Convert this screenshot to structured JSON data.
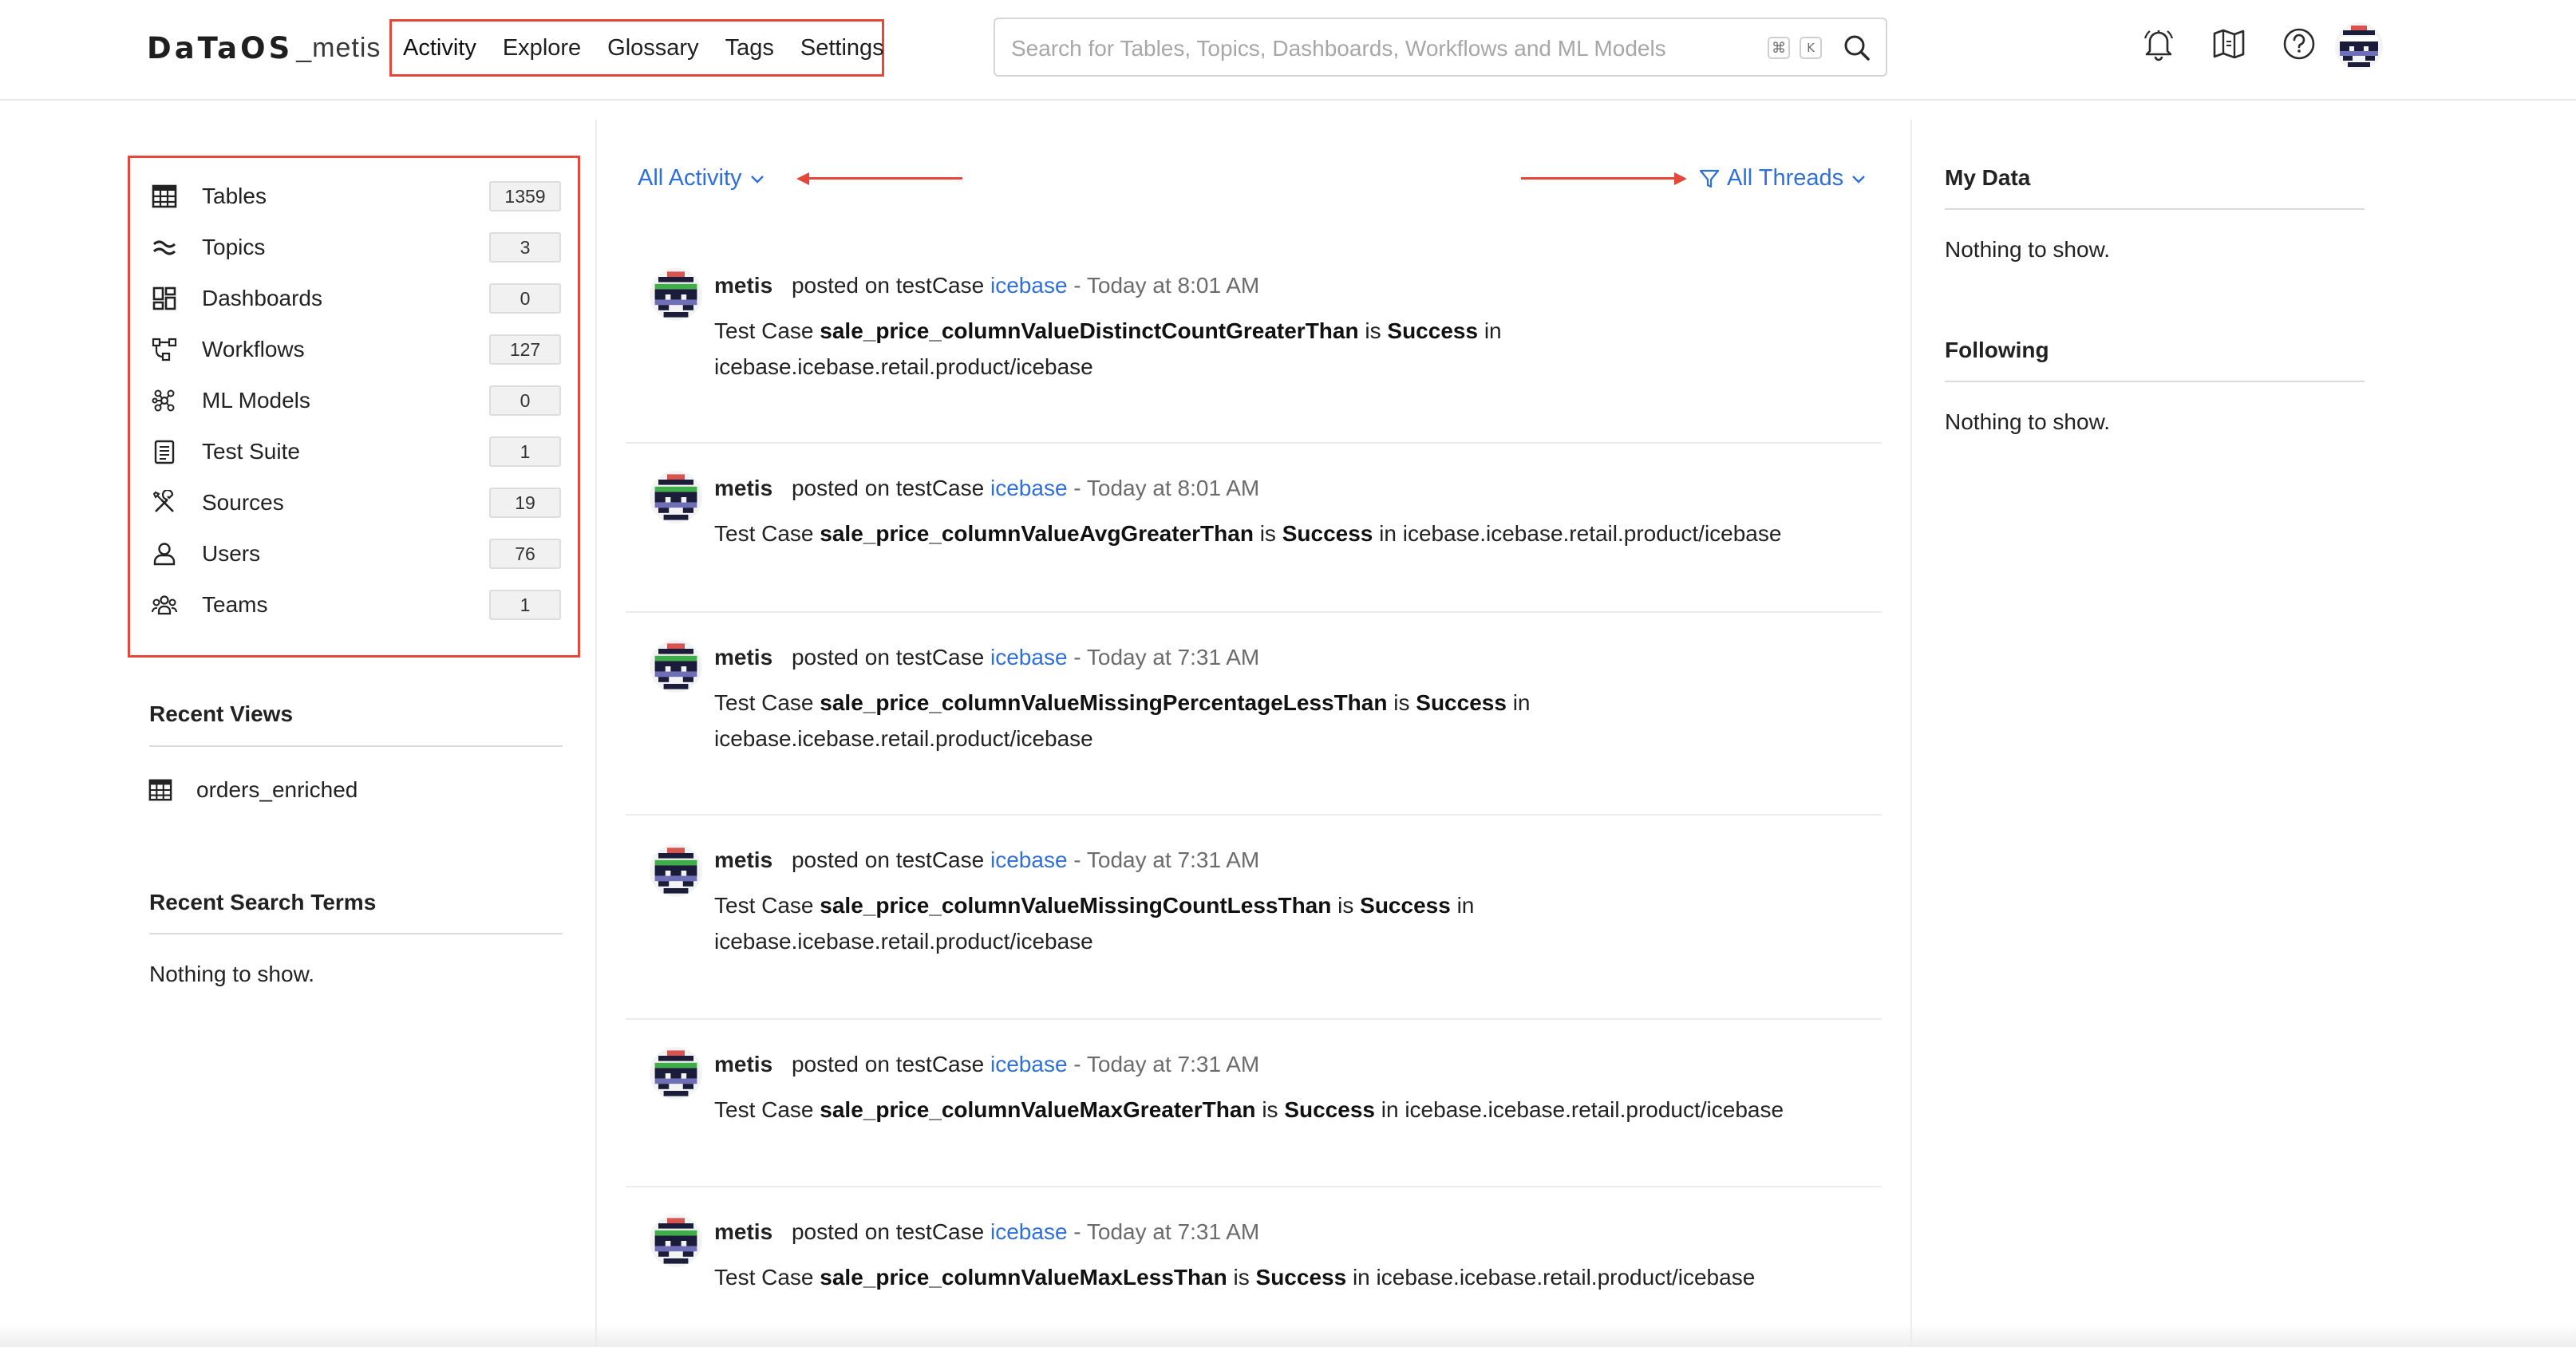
{
  "header": {
    "logo_main": "DaTaOS",
    "logo_sub": "_metis",
    "nav": [
      "Activity",
      "Explore",
      "Glossary",
      "Tags",
      "Settings"
    ],
    "search_placeholder": "Search for Tables, Topics, Dashboards, Workflows and ML Models",
    "kbd_cmd": "⌘",
    "kbd_k": "K",
    "icons": [
      "bell-icon",
      "map-icon",
      "help-icon",
      "user-avatar"
    ]
  },
  "sidebar": {
    "entities": [
      {
        "label": "Tables",
        "count": "1359",
        "icon": "table-icon"
      },
      {
        "label": "Topics",
        "count": "3",
        "icon": "topic-icon"
      },
      {
        "label": "Dashboards",
        "count": "0",
        "icon": "dashboard-icon"
      },
      {
        "label": "Workflows",
        "count": "127",
        "icon": "workflow-icon"
      },
      {
        "label": "ML Models",
        "count": "0",
        "icon": "ml-model-icon"
      },
      {
        "label": "Test Suite",
        "count": "1",
        "icon": "test-suite-icon"
      },
      {
        "label": "Sources",
        "count": "19",
        "icon": "sources-icon"
      },
      {
        "label": "Users",
        "count": "76",
        "icon": "user-icon"
      },
      {
        "label": "Teams",
        "count": "1",
        "icon": "teams-icon"
      }
    ],
    "recent_views_title": "Recent Views",
    "recent_views": [
      {
        "label": "orders_enriched",
        "icon": "table-icon"
      }
    ],
    "recent_search_title": "Recent Search Terms",
    "recent_search_empty": "Nothing to show."
  },
  "feed": {
    "filter_left": "All Activity",
    "filter_right": "All Threads",
    "items": [
      {
        "user": "metis",
        "action": "posted on testCase",
        "link": "icebase",
        "time": "- Today at 8:01 AM",
        "prefix": "Test Case",
        "test": "sale_price_columnValueDistinctCountGreaterThan",
        "is": "is",
        "status": "Success",
        "in": "in",
        "path": "icebase.icebase.retail.product/icebase"
      },
      {
        "user": "metis",
        "action": "posted on testCase",
        "link": "icebase",
        "time": "- Today at 8:01 AM",
        "prefix": "Test Case",
        "test": "sale_price_columnValueAvgGreaterThan",
        "is": "is",
        "status": "Success",
        "in": "in",
        "path": "icebase.icebase.retail.product/icebase"
      },
      {
        "user": "metis",
        "action": "posted on testCase",
        "link": "icebase",
        "time": "- Today at 7:31 AM",
        "prefix": "Test Case",
        "test": "sale_price_columnValueMissingPercentageLessThan",
        "is": "is",
        "status": "Success",
        "in": "in",
        "path": "icebase.icebase.retail.product/icebase"
      },
      {
        "user": "metis",
        "action": "posted on testCase",
        "link": "icebase",
        "time": "- Today at 7:31 AM",
        "prefix": "Test Case",
        "test": "sale_price_columnValueMissingCountLessThan",
        "is": "is",
        "status": "Success",
        "in": "in",
        "path": "icebase.icebase.retail.product/icebase"
      },
      {
        "user": "metis",
        "action": "posted on testCase",
        "link": "icebase",
        "time": "- Today at 7:31 AM",
        "prefix": "Test Case",
        "test": "sale_price_columnValueMaxGreaterThan",
        "is": "is",
        "status": "Success",
        "in": "in",
        "path": "icebase.icebase.retail.product/icebase"
      },
      {
        "user": "metis",
        "action": "posted on testCase",
        "link": "icebase",
        "time": "- Today at 7:31 AM",
        "prefix": "Test Case",
        "test": "sale_price_columnValueMaxLessThan",
        "is": "is",
        "status": "Success",
        "in": "in",
        "path": "icebase.icebase.retail.product/icebase"
      }
    ]
  },
  "right": {
    "my_data_title": "My Data",
    "my_data_empty": "Nothing to show.",
    "following_title": "Following",
    "following_empty": "Nothing to show."
  },
  "colors": {
    "accent": "#2f6fdb",
    "highlight": "#e5483b"
  }
}
